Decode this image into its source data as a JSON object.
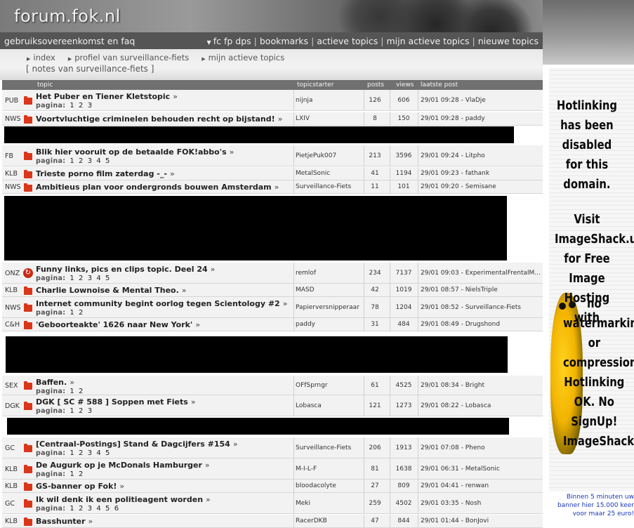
{
  "header": {
    "logo": "forum.fok.nl"
  },
  "navbar": {
    "left": "gebruiksovereenkomst en faq",
    "right_items": [
      "fc fp dps",
      "bookmarks",
      "actieve topics",
      "mijn actieve topics",
      "nieuwe topics"
    ]
  },
  "breadcrumb": {
    "items": [
      "index",
      "profiel van surveillance-fiets",
      "mijn actieve topics"
    ],
    "notes": "[ notes van surveillance-fiets ]"
  },
  "table": {
    "headers": {
      "topic": "topic",
      "starter": "topicstarter",
      "posts": "posts",
      "views": "views",
      "last": "laatste post"
    },
    "pagina_label": "pagina:",
    "rows": [
      {
        "cat": "PUB",
        "title": "Het Puber en Tiener Kletstopic",
        "pages": [
          "1",
          "2",
          "3"
        ],
        "starter": "nijnja",
        "posts": "126",
        "views": "606",
        "last": "29/01 09:28 - VlaDje"
      },
      {
        "cat": "NWS",
        "title": "Voortvluchtige criminelen behouden recht op bijstand!",
        "pages": [],
        "starter": "LXIV",
        "posts": "8",
        "views": "150",
        "last": "29/01 09:28 - paddy"
      },
      {
        "cat": "FB",
        "title": "Blik hier vooruit op de betaalde FOK!abbo's",
        "pages": [
          "1",
          "2",
          "3",
          "4",
          "5"
        ],
        "starter": "PietjePuk007",
        "posts": "213",
        "views": "3596",
        "last": "29/01 09:24 - Litpho"
      },
      {
        "cat": "KLB",
        "title": "Trieste porno film zaterdag -_-",
        "pages": [],
        "starter": "MetalSonic",
        "posts": "41",
        "views": "1194",
        "last": "29/01 09:23 - fathank"
      },
      {
        "cat": "NWS",
        "title": "Ambitieus plan voor ondergronds bouwen Amsterdam",
        "pages": [],
        "starter": "Surveillance-Fiets",
        "posts": "11",
        "views": "101",
        "last": "29/01 09:20 - Semisane"
      },
      {
        "cat": "ONZ",
        "title": "Funny links, pics en clips topic. Deel 24",
        "pages": [
          "1",
          "2",
          "3",
          "4",
          "5"
        ],
        "starter": "remlof",
        "posts": "234",
        "views": "7137",
        "last": "29/01 09:03 - ExperimentalFrentalM..."
      },
      {
        "cat": "KLB",
        "title": "Charlie Lownoise & Mental Theo.",
        "pages": [],
        "starter": "MASD",
        "posts": "42",
        "views": "1019",
        "last": "29/01 08:57 - NielsTriple"
      },
      {
        "cat": "NWS",
        "title": "Internet community begint oorlog tegen Scientology #2",
        "pages": [
          "1",
          "2"
        ],
        "starter": "Papierversnipperaar",
        "posts": "78",
        "views": "1204",
        "last": "29/01 08:52 - Surveillance-Fiets"
      },
      {
        "cat": "C&H",
        "title": "'Geboorteakte' 1626 naar New York'",
        "pages": [],
        "starter": "paddy",
        "posts": "31",
        "views": "484",
        "last": "29/01 08:49 - Drugshond"
      },
      {
        "cat": "SEX",
        "title": "Baffen.",
        "pages": [
          "1",
          "2"
        ],
        "starter": "OFfSprngr",
        "posts": "61",
        "views": "4525",
        "last": "29/01 08:34 - Bright"
      },
      {
        "cat": "DGK",
        "title": "DGK [ SC # 588 ] Soppen met Fiets",
        "pages": [
          "1",
          "2",
          "3"
        ],
        "starter": "Lobasca",
        "posts": "121",
        "views": "1273",
        "last": "29/01 08:22 - Lobasca"
      },
      {
        "cat": "GC",
        "title": "[Centraal-Postings] Stand & Dagcijfers #154",
        "pages": [
          "1",
          "2",
          "3",
          "4",
          "5"
        ],
        "starter": "Surveillance-Fiets",
        "posts": "206",
        "views": "1913",
        "last": "29/01 07:08 - Pheno"
      },
      {
        "cat": "KLB",
        "title": "De Augurk op je McDonals Hamburger",
        "pages": [
          "1",
          "2"
        ],
        "starter": "M-I-L-F",
        "posts": "81",
        "views": "1638",
        "last": "29/01 06:31 - MetalSonic"
      },
      {
        "cat": "KLB",
        "title": "GS-banner op Fok!",
        "pages": [],
        "starter": "bloodacolyte",
        "posts": "27",
        "views": "809",
        "last": "29/01 04:41 - renwan"
      },
      {
        "cat": "GC",
        "title": "Ik wil denk ik een politieagent worden",
        "pages": [
          "1",
          "2",
          "3",
          "4",
          "5",
          "6"
        ],
        "starter": "Meki",
        "posts": "259",
        "views": "4502",
        "last": "29/01 03:35 - Nosh"
      },
      {
        "cat": "KLB",
        "title": "Basshunter",
        "pages": [],
        "starter": "RacerDKB",
        "posts": "47",
        "views": "844",
        "last": "29/01 01:44 - BonJovi"
      }
    ]
  },
  "ad": {
    "text_top": "Hotlinking has been disabled for this domain.",
    "text_mid": "Visit ImageShack.us for Free Image Hosting with",
    "text_bottom": "no watermarking or compression. Hotlinking OK. No SignUp! ImageShack.us",
    "caption": "Binnen 5 minuten uw banner hier 15.000 keer voor maar 25 euro!"
  },
  "colors": {
    "navbar": "#555555",
    "folder": "#d9361a",
    "ad_caption": "#1a37b8"
  }
}
